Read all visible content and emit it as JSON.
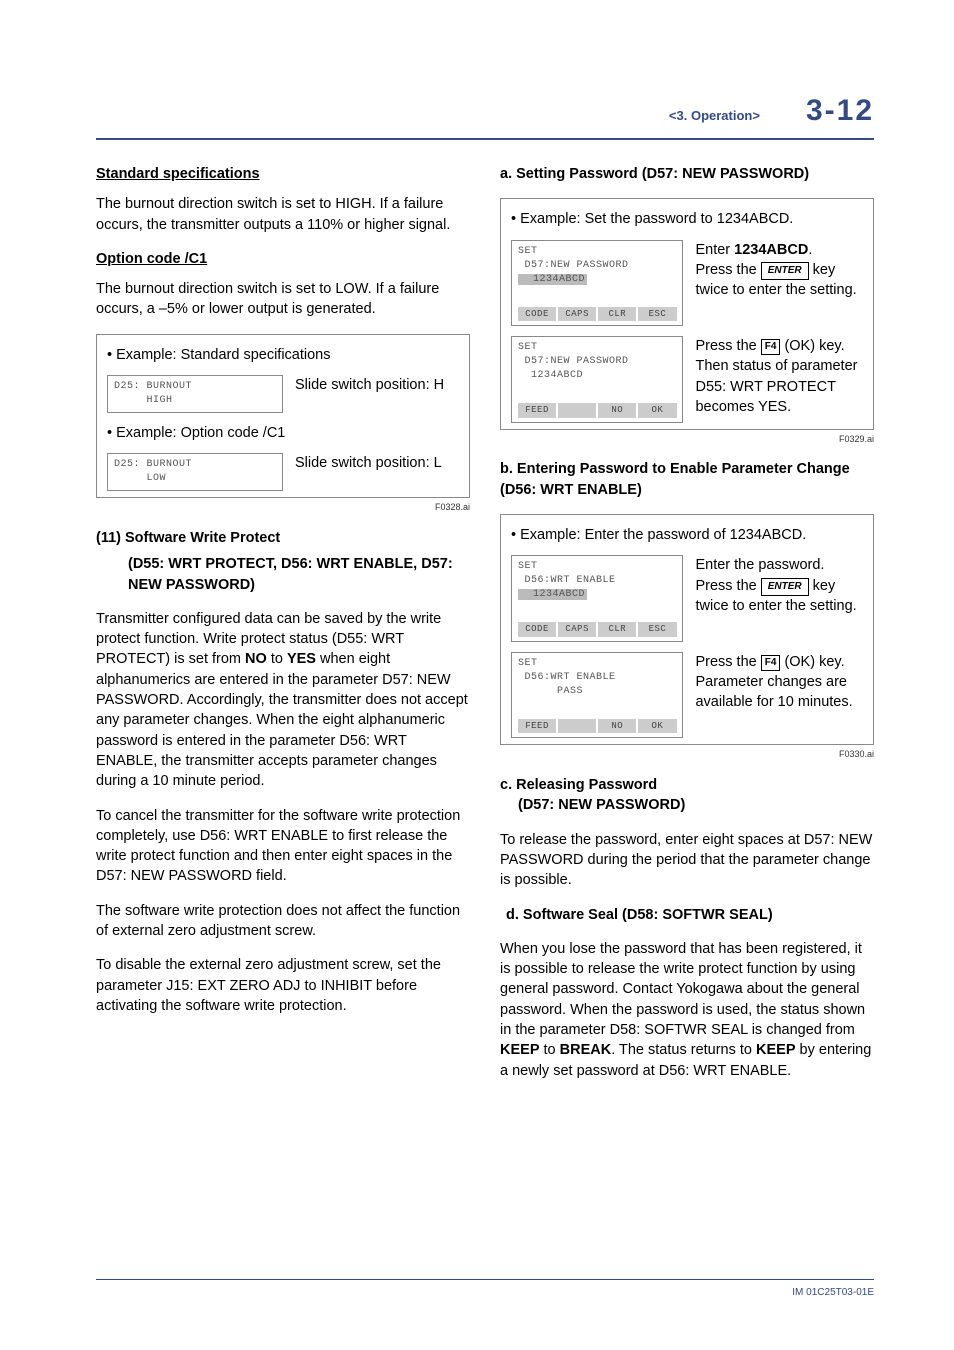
{
  "header": {
    "breadcrumb": "<3.  Operation>",
    "pagenum": "3-12"
  },
  "left": {
    "std_head": "Standard specifications",
    "std_p": "The burnout direction switch is set to HIGH. If a failure occurs, the transmitter outputs a 110% or higher signal.",
    "opt_head": "Option code /C1",
    "opt_p": "The burnout direction switch is set to LOW. If a failure occurs, a –5% or lower output is generated.",
    "box1": {
      "t1": "• Example: Standard specifications",
      "screen1_l1": "D25: BURNOUT",
      "screen1_l2": "     HIGH",
      "cap1": "Slide switch position: H",
      "t2": "• Example: Option code /C1",
      "screen2_l1": "D25: BURNOUT",
      "screen2_l2": "     LOW",
      "cap2": "Slide switch position: L"
    },
    "fn1": "F0328.ai",
    "h11": "(11)  Software Write Protect",
    "h11b": "(D55: WRT PROTECT, D56: WRT ENABLE, D57: NEW PASSWORD)",
    "p1a": "Transmitter configured data can be saved by the write protect function. Write protect status (D55: WRT PROTECT) is set from ",
    "p1b": "NO",
    "p1c": " to ",
    "p1d": "YES",
    "p1e": " when eight alphanumerics are entered in the parameter D57: NEW PASSWORD. Accordingly, the transmitter does not accept any parameter changes. When the eight alphanumeric password is entered in the parameter D56: WRT ENABLE, the transmitter accepts parameter changes during a 10 minute period.",
    "p2": "To cancel the transmitter for the software write protection completely, use D56: WRT ENABLE to first release the write protect function and then enter eight spaces in the D57: NEW PASSWORD field.",
    "p3": "The software write protection does not affect the function of external zero adjustment screw.",
    "p4": "To disable the external zero adjustment screw, set the parameter J15: EXT ZERO ADJ to INHIBIT before activating the software write protection."
  },
  "right": {
    "a_head": "a. Setting Password (D57: NEW PASSWORD)",
    "a_ex": "• Example: Set the password to 1234ABCD.",
    "a_s1": {
      "l0": "SET",
      "l1": " D57:NEW PASSWORD",
      "l2": "  1234ABCD",
      "btns": [
        "CODE",
        "CAPS",
        "CLR",
        "ESC"
      ]
    },
    "a_r1a": "Enter ",
    "a_r1b": "1234ABCD",
    "a_r1c": ".",
    "a_r1d": "Press the ",
    "a_r1e": " key twice to enter the setting.",
    "key_enter": "ENTER",
    "a_s2": {
      "l0": "SET",
      "l1": " D57:NEW PASSWORD",
      "l2": "  1234ABCD",
      "btns": [
        "FEED",
        "",
        "NO",
        "OK"
      ]
    },
    "a_r2a": "Press the ",
    "key_f4": "F4",
    "a_r2b": " (OK) key.",
    "a_r2c": "Then status of parameter D55: WRT PROTECT becomes YES.",
    "fn2": "F0329.ai",
    "b_head": "b. Entering Password to Enable Parameter Change (D56: WRT ENABLE)",
    "b_ex": "• Example: Enter the password of 1234ABCD.",
    "b_s1": {
      "l0": "SET",
      "l1": " D56:WRT ENABLE",
      "l2": "  1234ABCD",
      "btns": [
        "CODE",
        "CAPS",
        "CLR",
        "ESC"
      ]
    },
    "b_r1a": "Enter the password.",
    "b_r1b": "Press the ",
    "b_r1c": " key twice to enter the setting.",
    "b_s2": {
      "l0": "SET",
      "l1": " D56:WRT ENABLE",
      "l2": "      PASS",
      "btns": [
        "FEED",
        "",
        "NO",
        "OK"
      ]
    },
    "b_r2a": "Press the ",
    "b_r2b": " (OK) key.",
    "b_r2c": "Parameter changes are available for 10 minutes.",
    "fn3": "F0330.ai",
    "c_head1": "c. Releasing Password",
    "c_head2": "(D57: NEW PASSWORD)",
    "c_p": "To release the password, enter eight spaces at D57: NEW PASSWORD during the period that the parameter change is possible.",
    "d_head": "d. Software Seal (D58: SOFTWR SEAL)",
    "d_p_a": "When you lose the password that has been registered, it is possible to release the write protect function by using general password. Contact Yokogawa about the general password. When the password is used, the status shown in the parameter D58: SOFTWR SEAL is changed from ",
    "d_p_b": "KEEP",
    "d_p_c": " to ",
    "d_p_d": "BREAK",
    "d_p_e": ". The status returns to ",
    "d_p_f": "KEEP",
    "d_p_g": " by entering a newly set password at D56: WRT ENABLE."
  },
  "footer": {
    "id": "IM 01C25T03-01E"
  }
}
